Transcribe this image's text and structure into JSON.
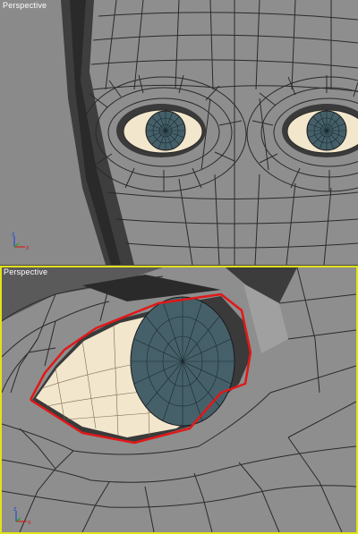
{
  "viewports": {
    "top": {
      "label": "Perspective",
      "active": false
    },
    "bottom": {
      "label": "Perspective",
      "active": true
    }
  },
  "axis_gizmo": {
    "z": "z",
    "x": "x",
    "y": "y"
  },
  "colors": {
    "active_border": "#e2e21c",
    "selection_edge": "#e01818",
    "mesh_face": "#8c8c8c",
    "mesh_edge": "#2a2a2a",
    "iris": "#46606a",
    "sclera": "#f2e6cc",
    "axis_x": "#d02020",
    "axis_y": "#20a020",
    "axis_z": "#2050d0"
  }
}
